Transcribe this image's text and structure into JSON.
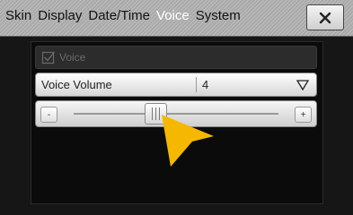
{
  "header": {
    "tabs": [
      {
        "label": "Skin",
        "active": false
      },
      {
        "label": "Display",
        "active": false
      },
      {
        "label": "Date/Time",
        "active": false
      },
      {
        "label": "Voice",
        "active": true
      },
      {
        "label": "System",
        "active": false
      }
    ],
    "close_icon": "close-x-icon"
  },
  "voice": {
    "label": "Voice",
    "checked": true
  },
  "volume": {
    "label": "Voice Volume",
    "value": "4",
    "dropdown_icon": "triangle-down-icon"
  },
  "slider": {
    "minus_label": "-",
    "plus_label": "+",
    "level_fraction": 0.4
  },
  "colors": {
    "active_tab": "#ffffff",
    "cursor": "#f5b700"
  }
}
